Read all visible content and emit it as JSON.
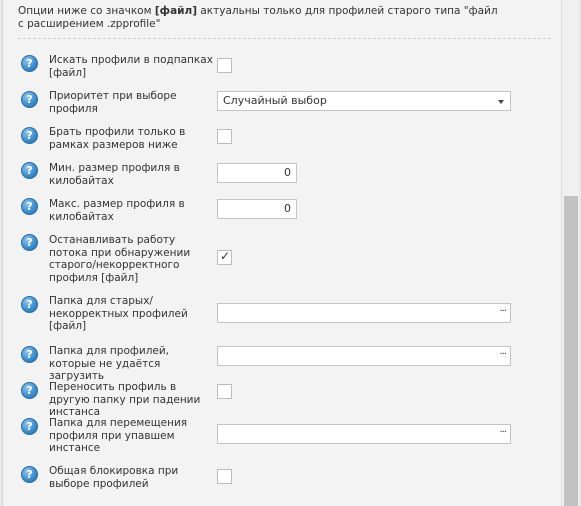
{
  "note": {
    "prefix": "Опции ниже со значком ",
    "bold": "[файл]",
    "suffix": " актуальны только для профилей старого типа \"файл с расширением .zpprofile\""
  },
  "help_glyph": "?",
  "check_glyph": "✓",
  "dots_glyph": "···",
  "options": [
    {
      "id": "search-subfolders",
      "label": "Искать профили в подпапках [файл]",
      "type": "checkbox",
      "checked": false
    },
    {
      "id": "profile-priority",
      "label": "Приоритет при выборе профиля",
      "type": "select",
      "value": "Случайный выбор"
    },
    {
      "id": "size-range-only",
      "label": "Брать профили только в рамках размеров ниже",
      "type": "checkbox",
      "checked": false
    },
    {
      "id": "min-size",
      "label": "Мин. размер профиля в килобайтах",
      "type": "number",
      "value": "0"
    },
    {
      "id": "max-size",
      "label": "Макс. размер профиля в килобайтах",
      "type": "number",
      "value": "0"
    },
    {
      "id": "stop-on-old",
      "label": "Останавливать работу потока при обнаружении старого/некорректного профиля [файл]",
      "type": "checkbox",
      "checked": true
    },
    {
      "id": "old-folder",
      "label": "Папка для старых/некорректных профилей [файл]",
      "type": "path",
      "value": ""
    },
    {
      "id": "failed-folder",
      "label": "Папка для профилей, которые не удаётся загрузить",
      "type": "path",
      "value": ""
    },
    {
      "id": "move-on-crash",
      "label": "Переносить профиль в другую папку при падении инстанса",
      "type": "checkbox",
      "checked": false
    },
    {
      "id": "crash-folder",
      "label": "Папка для перемещения профиля при упавшем инстансе",
      "type": "path",
      "value": ""
    },
    {
      "id": "global-lock",
      "label": "Общая блокировка при выборе профилей",
      "type": "checkbox",
      "checked": false
    }
  ]
}
